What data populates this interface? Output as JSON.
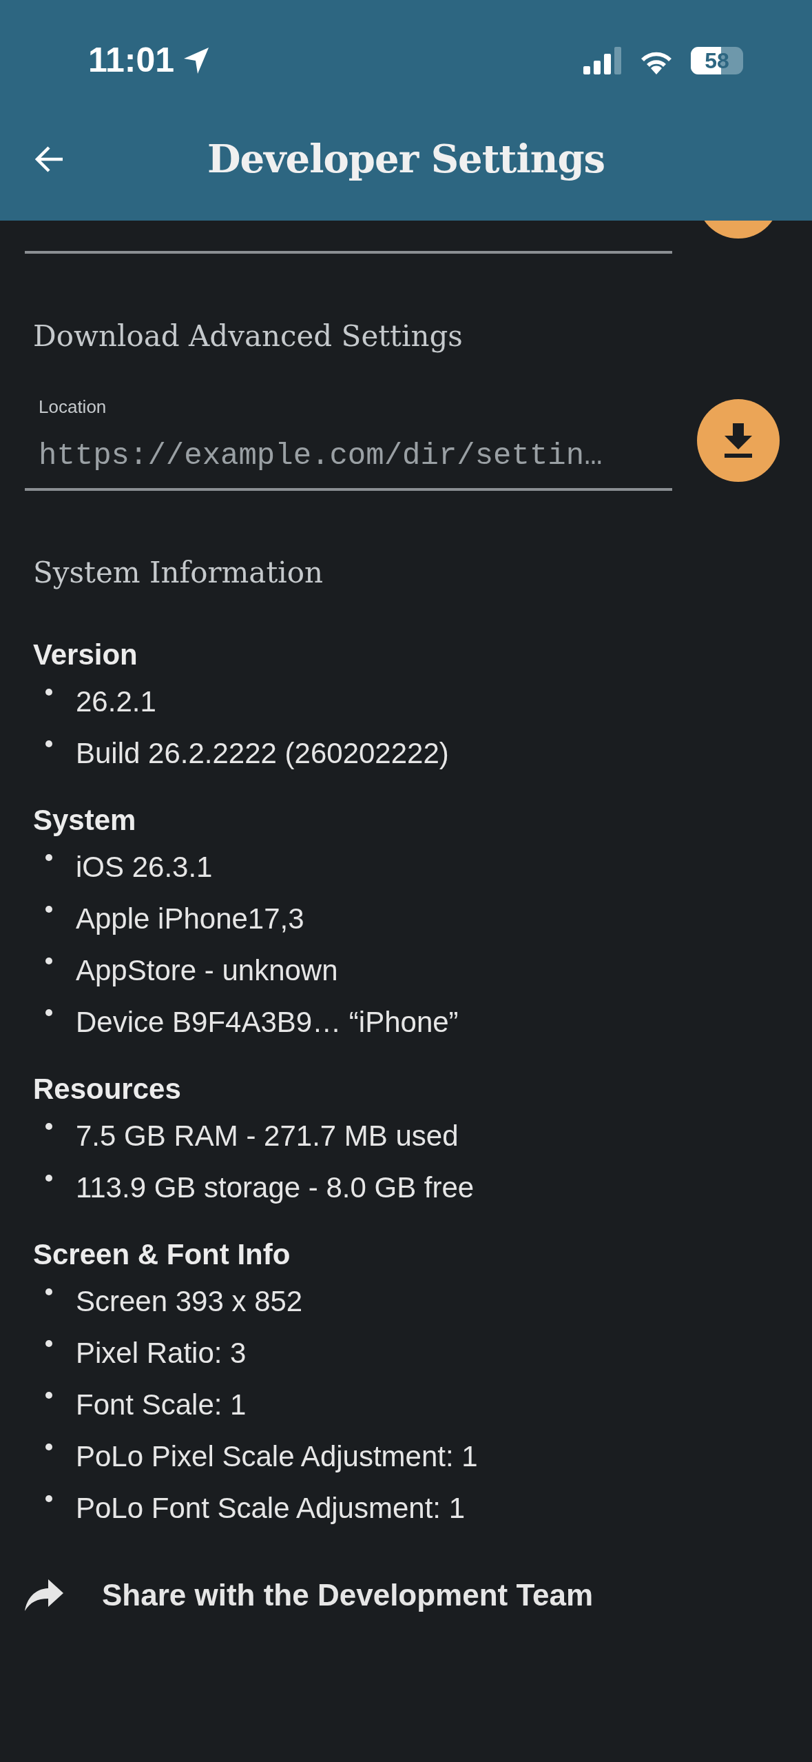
{
  "status_bar": {
    "time": "11:01",
    "battery": "58"
  },
  "header": {
    "title": "Developer Settings"
  },
  "download_section": {
    "title": "Download Advanced Settings",
    "field": {
      "label": "Location",
      "placeholder": "https://example.com/dir/settin…"
    }
  },
  "system_information": {
    "title": "System Information",
    "groups": [
      {
        "title": "Version",
        "items": [
          "26.2.1",
          "Build 26.2.2222 (260202222)"
        ]
      },
      {
        "title": "System",
        "items": [
          "iOS 26.3.1",
          "Apple iPhone17,3",
          "AppStore - unknown",
          "Device B9F4A3B9… “iPhone”"
        ]
      },
      {
        "title": "Resources",
        "items": [
          "7.5 GB RAM - 271.7 MB used",
          "113.9 GB storage - 8.0 GB free"
        ]
      },
      {
        "title": "Screen & Font Info",
        "items": [
          "Screen 393 x 852",
          "Pixel Ratio: 3",
          "Font Scale: 1",
          "PoLo Pixel Scale Adjustment: 1",
          "PoLo Font Scale Adjusment: 1"
        ]
      }
    ]
  },
  "share": {
    "label": "Share with the Development Team"
  }
}
